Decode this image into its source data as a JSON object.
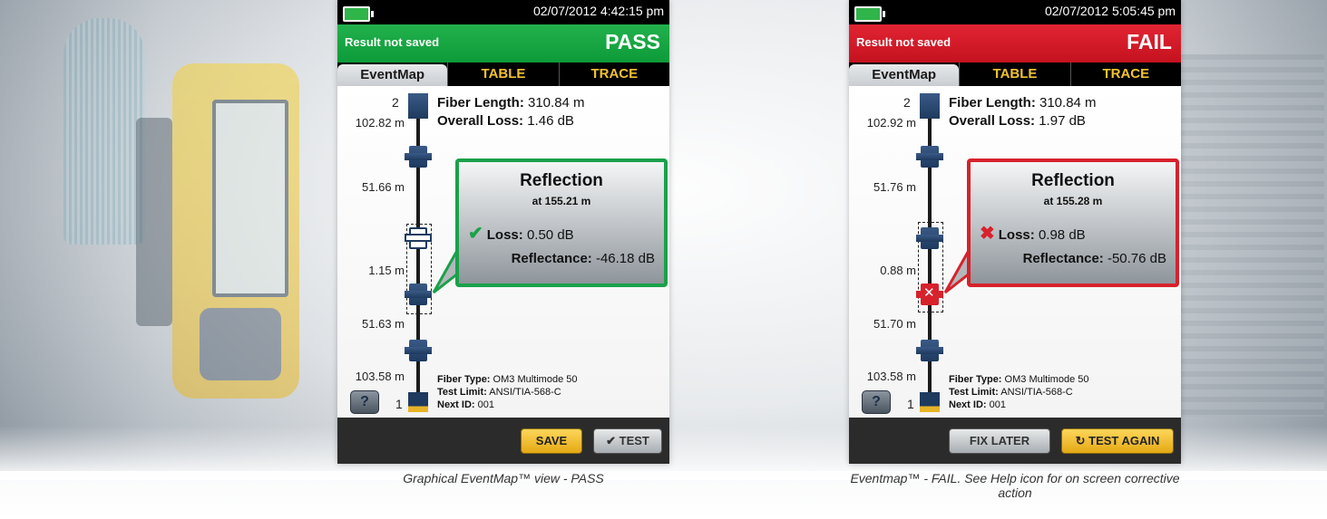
{
  "left_screen": {
    "datetime": "02/07/2012 4:42:15 pm",
    "result_note": "Result not saved",
    "verdict": "PASS",
    "tabs": [
      "EventMap",
      "TABLE",
      "TRACE"
    ],
    "fiber_length_label": "Fiber Length:",
    "fiber_length_value": "310.84 m",
    "overall_loss_label": "Overall Loss:",
    "overall_loss_value": "1.46 dB",
    "top_node": "2",
    "bottom_node": "1",
    "distances": [
      "102.82 m",
      "51.66 m",
      "1.15 m",
      "51.63 m",
      "103.58 m"
    ],
    "popup": {
      "title": "Reflection",
      "subtitle": "at 155.21 m",
      "loss_label": "Loss:",
      "loss_value": "0.50 dB",
      "reflectance_label": "Reflectance:",
      "reflectance_value": "-46.18 dB",
      "status_icon": "check-icon"
    },
    "fiber_type_label": "Fiber Type:",
    "fiber_type_value": "OM3 Multimode 50",
    "test_limit_label": "Test Limit:",
    "test_limit_value": "ANSI/TIA-568-C",
    "next_id_label": "Next ID:",
    "next_id_value": "001",
    "help_label": "?",
    "buttons": {
      "save": "SAVE",
      "test": "TEST"
    },
    "caption": "Graphical EventMap™ view - PASS",
    "accent_color": "#1ba14b"
  },
  "right_screen": {
    "datetime": "02/07/2012 5:05:45 pm",
    "result_note": "Result not saved",
    "verdict": "FAIL",
    "tabs": [
      "EventMap",
      "TABLE",
      "TRACE"
    ],
    "fiber_length_label": "Fiber Length:",
    "fiber_length_value": "310.84 m",
    "overall_loss_label": "Overall Loss:",
    "overall_loss_value": "1.97 dB",
    "top_node": "2",
    "bottom_node": "1",
    "distances": [
      "102.92 m",
      "51.76 m",
      "0.88 m",
      "51.70 m",
      "103.58 m"
    ],
    "popup": {
      "title": "Reflection",
      "subtitle": "at 155.28 m",
      "loss_label": "Loss:",
      "loss_value": "0.98 dB",
      "reflectance_label": "Reflectance:",
      "reflectance_value": "-50.76 dB",
      "status_icon": "x-icon"
    },
    "fiber_type_label": "Fiber Type:",
    "fiber_type_value": "OM3 Multimode 50",
    "test_limit_label": "Test Limit:",
    "test_limit_value": "ANSI/TIA-568-C",
    "next_id_label": "Next ID:",
    "next_id_value": "001",
    "help_label": "?",
    "buttons": {
      "fix_later": "FIX LATER",
      "test_again": "TEST AGAIN"
    },
    "caption": "Eventmap™ - FAIL. See Help icon for on screen corrective action",
    "accent_color": "#d7222c"
  }
}
